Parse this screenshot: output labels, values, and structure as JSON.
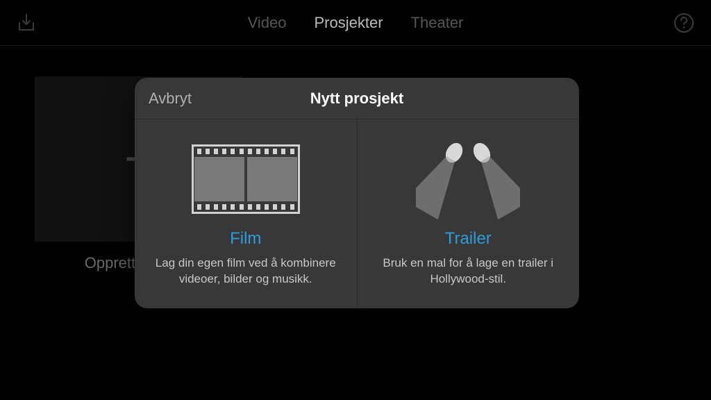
{
  "header": {
    "tabs": {
      "video": "Video",
      "projects": "Prosjekter",
      "theater": "Theater"
    }
  },
  "card": {
    "label": "Opprett prosjekt"
  },
  "modal": {
    "cancel": "Avbryt",
    "title": "Nytt prosjekt",
    "film": {
      "title": "Film",
      "desc": "Lag din egen film ved å kombinere videoer, bilder og musikk."
    },
    "trailer": {
      "title": "Trailer",
      "desc": "Bruk en mal for å lage en trailer i Hollywood-stil."
    }
  }
}
